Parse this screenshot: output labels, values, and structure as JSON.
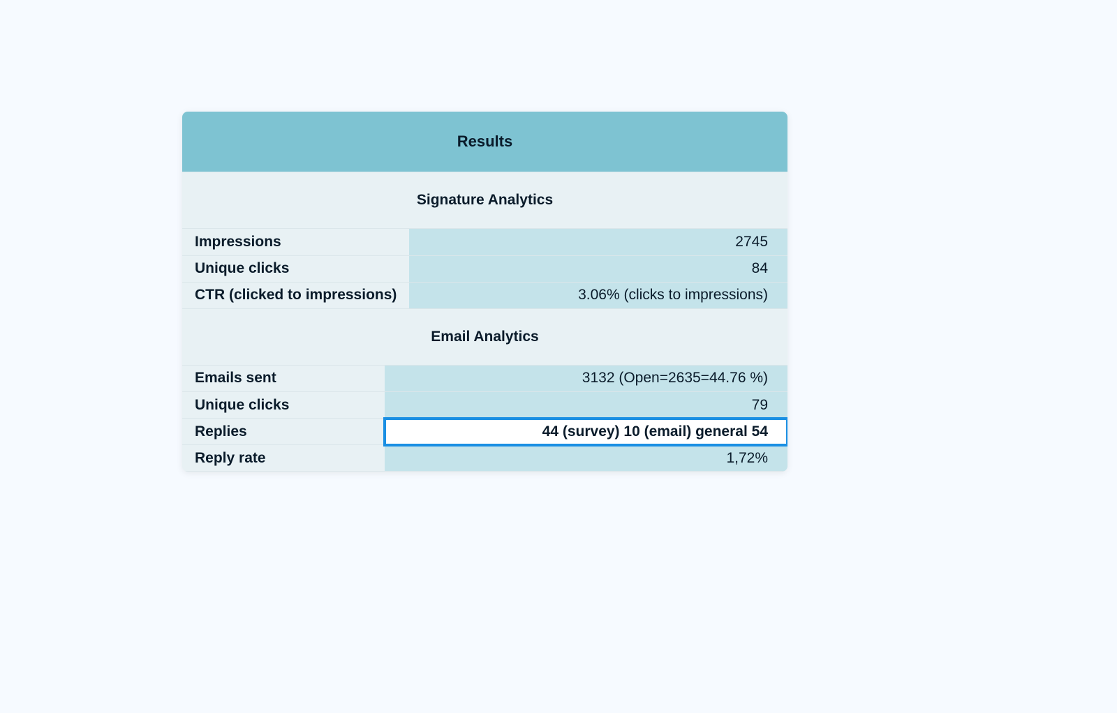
{
  "results": {
    "title": "Results",
    "signature": {
      "title": "Signature Analytics",
      "rows": [
        {
          "label": "Impressions",
          "value": "2745"
        },
        {
          "label": "Unique clicks",
          "value": "84"
        },
        {
          "label": "CTR (clicked to impressions)",
          "value": "3.06% (clicks to impressions)"
        }
      ]
    },
    "email": {
      "title": "Email Analytics",
      "rows": [
        {
          "label": "Emails sent",
          "value": "3132 (Open=2635=44.76 %)"
        },
        {
          "label": "Unique clicks",
          "value": "79"
        },
        {
          "label": "Replies",
          "value": "44 (survey) 10 (email) general 54"
        },
        {
          "label": "Reply rate",
          "value": "1,72%"
        }
      ]
    }
  }
}
